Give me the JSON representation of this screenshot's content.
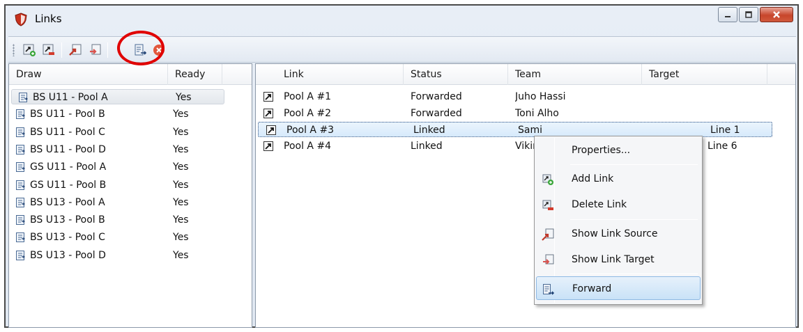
{
  "window": {
    "title": "Links",
    "icon": "shield-app-icon",
    "controls": [
      "minimize-icon",
      "maximize-icon",
      "close-icon"
    ]
  },
  "toolbar": {
    "buttons": [
      {
        "name": "add-link-button",
        "icon": "add-link-icon"
      },
      {
        "name": "delete-link-button",
        "icon": "delete-link-icon"
      },
      {
        "name": "show-link-source-button",
        "icon": "show-link-source-icon"
      },
      {
        "name": "show-link-target-button",
        "icon": "show-link-target-icon"
      },
      {
        "name": "forward-button",
        "icon": "forward-icon"
      },
      {
        "name": "close-pane-button",
        "icon": "red-x-icon"
      }
    ],
    "highlight_color": "#e00000"
  },
  "draws": {
    "columns": [
      "Draw",
      "Ready"
    ],
    "rows": [
      {
        "draw": "BS U11 - Pool A",
        "ready": "Yes"
      },
      {
        "draw": "BS U11 - Pool B",
        "ready": "Yes"
      },
      {
        "draw": "BS U11 - Pool C",
        "ready": "Yes"
      },
      {
        "draw": "BS U11 - Pool D",
        "ready": "Yes"
      },
      {
        "draw": "GS U11 - Pool A",
        "ready": "Yes"
      },
      {
        "draw": "GS U11 - Pool B",
        "ready": "Yes"
      },
      {
        "draw": "BS U13 - Pool A",
        "ready": "Yes"
      },
      {
        "draw": "BS U13 - Pool B",
        "ready": "Yes"
      },
      {
        "draw": "BS U13 - Pool C",
        "ready": "Yes"
      },
      {
        "draw": "BS U13 - Pool D",
        "ready": "Yes"
      }
    ],
    "selected_index": 0
  },
  "links": {
    "columns": [
      "Link",
      "Status",
      "Team",
      "Target"
    ],
    "rows": [
      {
        "link": "Pool A #1",
        "status": "Forwarded",
        "team": "Juho Hassi",
        "target": ""
      },
      {
        "link": "Pool A #2",
        "status": "Forwarded",
        "team": "Toni Alho",
        "target": ""
      },
      {
        "link": "Pool A #3",
        "status": "Linked",
        "team": "Sami",
        "target": "Line 1"
      },
      {
        "link": "Pool A #4",
        "status": "Linked",
        "team": "Vikir",
        "target": "Line 6"
      }
    ],
    "selected_index": 2
  },
  "context_menu": {
    "items": [
      {
        "label": "Properties...",
        "icon": ""
      },
      {
        "label": "Add Link",
        "icon": "add-link-icon"
      },
      {
        "label": "Delete Link",
        "icon": "delete-link-icon"
      },
      {
        "label": "Show Link Source",
        "icon": "show-link-source-icon"
      },
      {
        "label": "Show Link Target",
        "icon": "show-link-target-icon"
      },
      {
        "label": "Forward",
        "icon": "forward-icon"
      }
    ],
    "active_index": 5
  }
}
